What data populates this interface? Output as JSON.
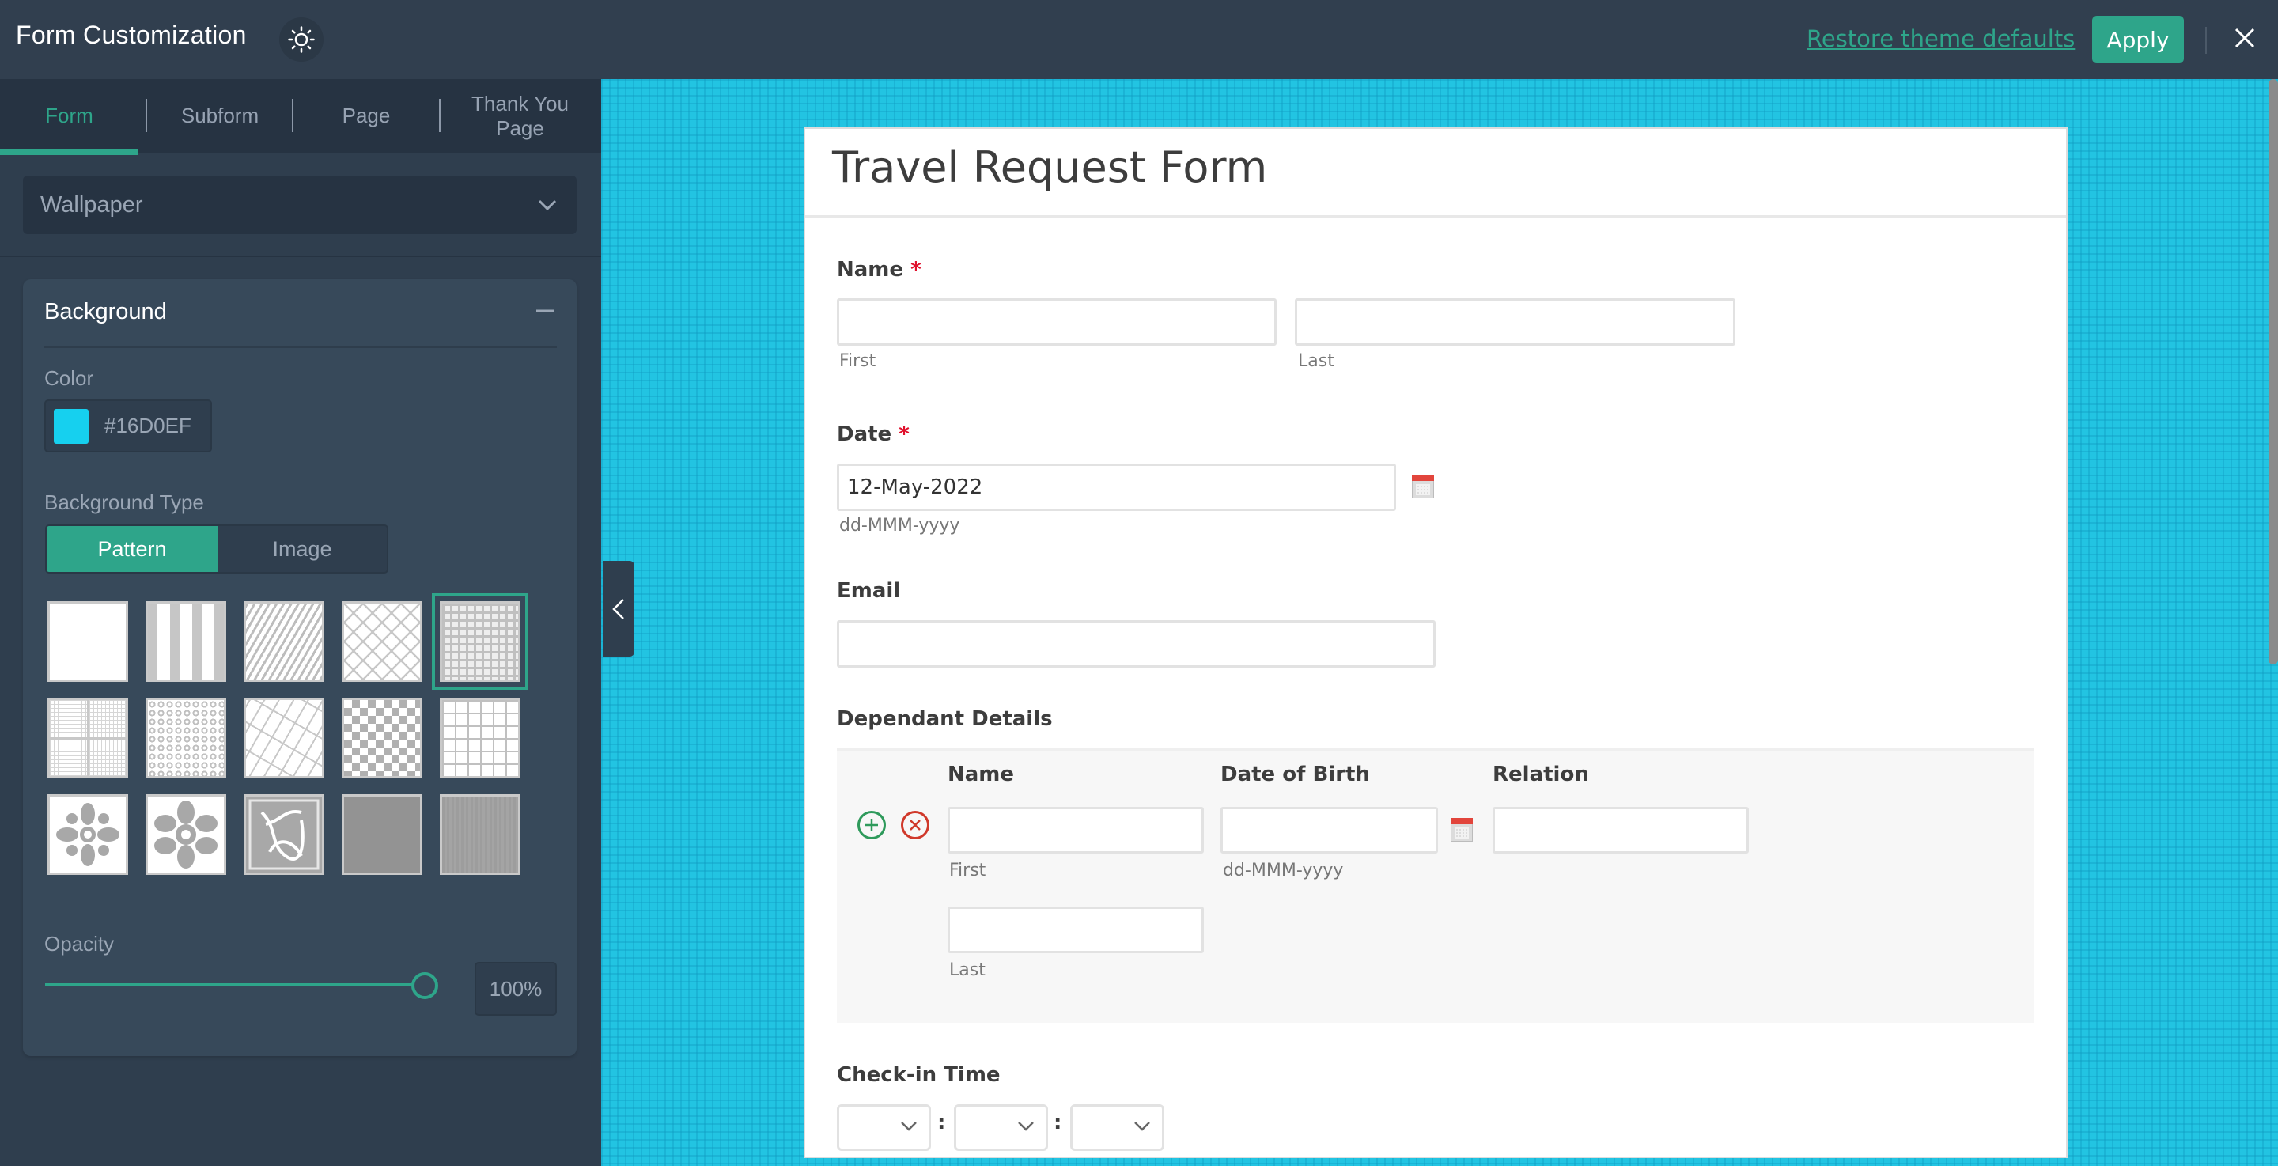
{
  "header": {
    "title": "Form Customization",
    "theme_icon": "sun-icon",
    "restore_label": "Restore theme defaults",
    "apply_label": "Apply",
    "close_icon": "close-icon"
  },
  "tabs": [
    {
      "label": "Form",
      "active": true
    },
    {
      "label": "Subform",
      "active": false
    },
    {
      "label": "Page",
      "active": false
    },
    {
      "label": "Thank You Page",
      "active": false
    }
  ],
  "section_dropdown": {
    "value": "Wallpaper"
  },
  "background": {
    "title": "Background",
    "color_label": "Color",
    "color_value": "#16D0EF",
    "type_label": "Background Type",
    "type_options": [
      "Pattern",
      "Image"
    ],
    "type_selected": "Pattern",
    "patterns": [
      "plain",
      "vertical-stripes",
      "diagonal-stripes",
      "diamond-lattice",
      "small-squares",
      "fine-grid",
      "circles",
      "brick-diagonal",
      "checkerboard",
      "square-chain",
      "flower-ornament",
      "petal-flower",
      "celtic-knot",
      "gray-texture",
      "gray-linen"
    ],
    "selected_pattern_index": 4,
    "opacity_label": "Opacity",
    "opacity_percent": 100,
    "opacity_text": "100%"
  },
  "colors": {
    "accent": "#2EA58A",
    "canvas_bg": "#16D0EF",
    "required": "#E0102C"
  },
  "form": {
    "title": "Travel Request Form",
    "fields": {
      "name": {
        "label": "Name",
        "required_mark": "*",
        "first_label": "First",
        "last_label": "Last",
        "first_value": "",
        "last_value": ""
      },
      "date": {
        "label": "Date",
        "required_mark": "*",
        "value": "12-May-2022",
        "format_hint": "dd-MMM-yyyy"
      },
      "email": {
        "label": "Email",
        "value": ""
      },
      "dependants": {
        "label": "Dependant Details",
        "columns": [
          "Name",
          "Date of Birth",
          "Relation"
        ],
        "row": {
          "first_label": "First",
          "last_label": "Last",
          "dob_hint": "dd-MMM-yyyy"
        }
      },
      "checkin": {
        "label": "Check-in Time",
        "separator": ":",
        "hour": "",
        "minute": "",
        "second": ""
      }
    }
  }
}
